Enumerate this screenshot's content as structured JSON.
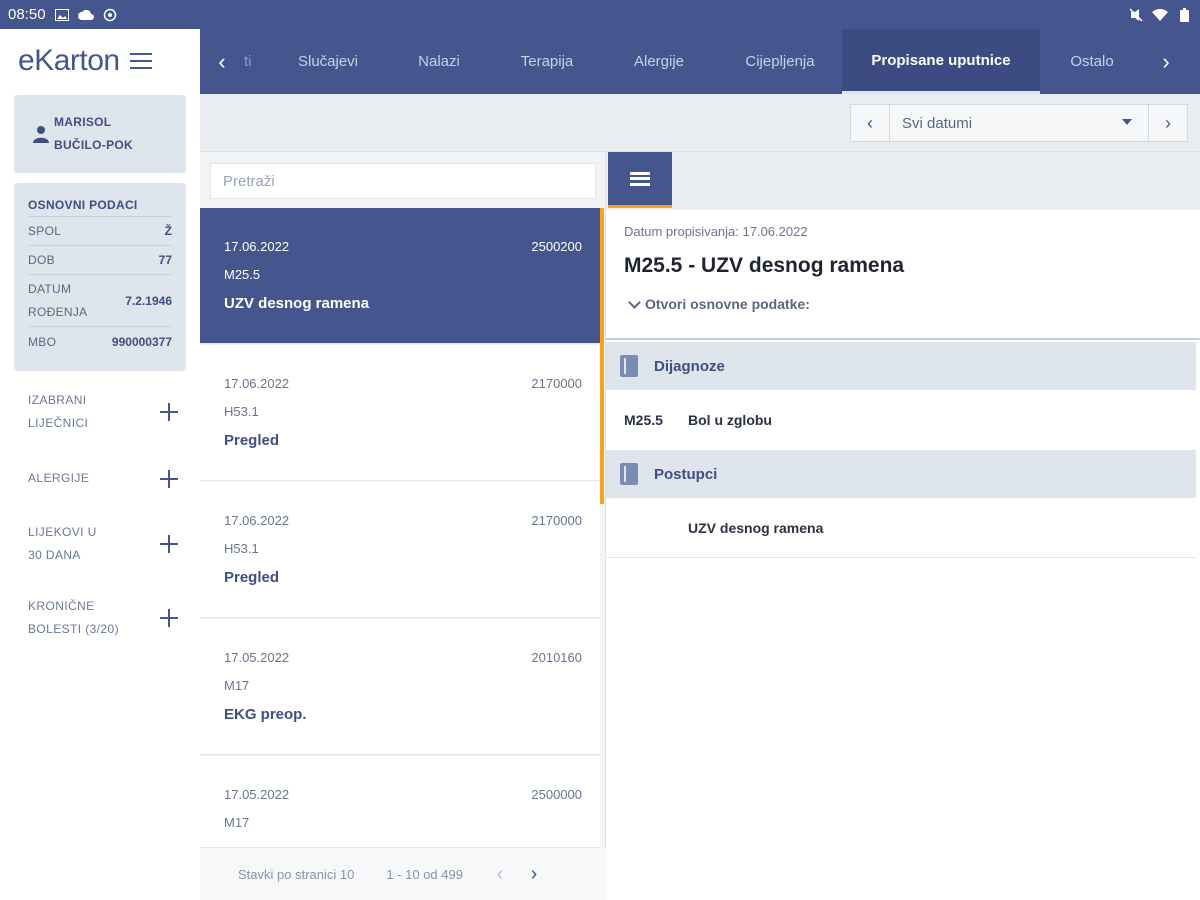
{
  "status": {
    "time": "08:50"
  },
  "app": {
    "brand": "eKarton"
  },
  "patient": {
    "name_line1": "MARISOL",
    "name_line2": "BUČILO-POK"
  },
  "basic": {
    "title": "OSNOVNI PODACI",
    "rows": [
      {
        "label": "SPOL",
        "value": "Ž"
      },
      {
        "label": "DOB",
        "value": "77"
      },
      {
        "label": "DATUM ROĐENJA",
        "label_line1": "DATUM",
        "label_line2": "ROĐENJA",
        "value": "7.2.1946"
      },
      {
        "label": "MBO",
        "value": "990000377"
      }
    ]
  },
  "sidebar_sections": [
    {
      "line1": "IZABRANI",
      "line2": "LIJEČNICI"
    },
    {
      "line1": "ALERGIJE",
      "line2": ""
    },
    {
      "line1": "LIJEKOVI U",
      "line2": "30 DANA"
    },
    {
      "line1": "KRONIČNE",
      "line2": "BOLESTI (3/20)"
    }
  ],
  "tabs": {
    "partial": "ti",
    "items": [
      "Slučajevi",
      "Nalazi",
      "Terapija",
      "Alergije",
      "Cijepljenja",
      "Propisane uputnice",
      "Ostalo"
    ],
    "active_index": 5
  },
  "filter": {
    "date_select": "Svi datumi"
  },
  "search": {
    "placeholder": "Pretraži"
  },
  "list": [
    {
      "date": "17.06.2022",
      "number": "2500200",
      "code": "M25.5",
      "title": "UZV desnog ramena"
    },
    {
      "date": "17.06.2022",
      "number": "2170000",
      "code": "H53.1",
      "title": "Pregled"
    },
    {
      "date": "17.06.2022",
      "number": "2170000",
      "code": "H53.1",
      "title": "Pregled"
    },
    {
      "date": "17.05.2022",
      "number": "2010160",
      "code": "M17",
      "title": "EKG preop."
    },
    {
      "date": "17.05.2022",
      "number": "2500000",
      "code": "M17",
      "title": ""
    }
  ],
  "pager": {
    "per_page": "Stavki po stranici 10",
    "range": "1 - 10 od 499"
  },
  "detail": {
    "date_line": "Datum propisivanja: 17.06.2022",
    "title": "M25.5 - UZV desnog ramena",
    "toggle": "Otvori osnovne podatke:",
    "diagnoses_title": "Dijagnoze",
    "diagnoses": [
      {
        "code": "M25.5",
        "text": "Bol u zglobu"
      }
    ],
    "procedures_title": "Postupci",
    "procedures": [
      {
        "code": "",
        "text": "UZV desnog ramena"
      }
    ]
  },
  "colors": {
    "primary": "#45568f",
    "accent": "#f7a31c",
    "panel": "#dfe5ec"
  },
  "icons": [
    "image-icon",
    "cloud-icon",
    "sync-icon",
    "mute-icon",
    "wifi-icon",
    "battery-icon",
    "person-icon",
    "plus-icon",
    "book-icon",
    "list-icon"
  ]
}
